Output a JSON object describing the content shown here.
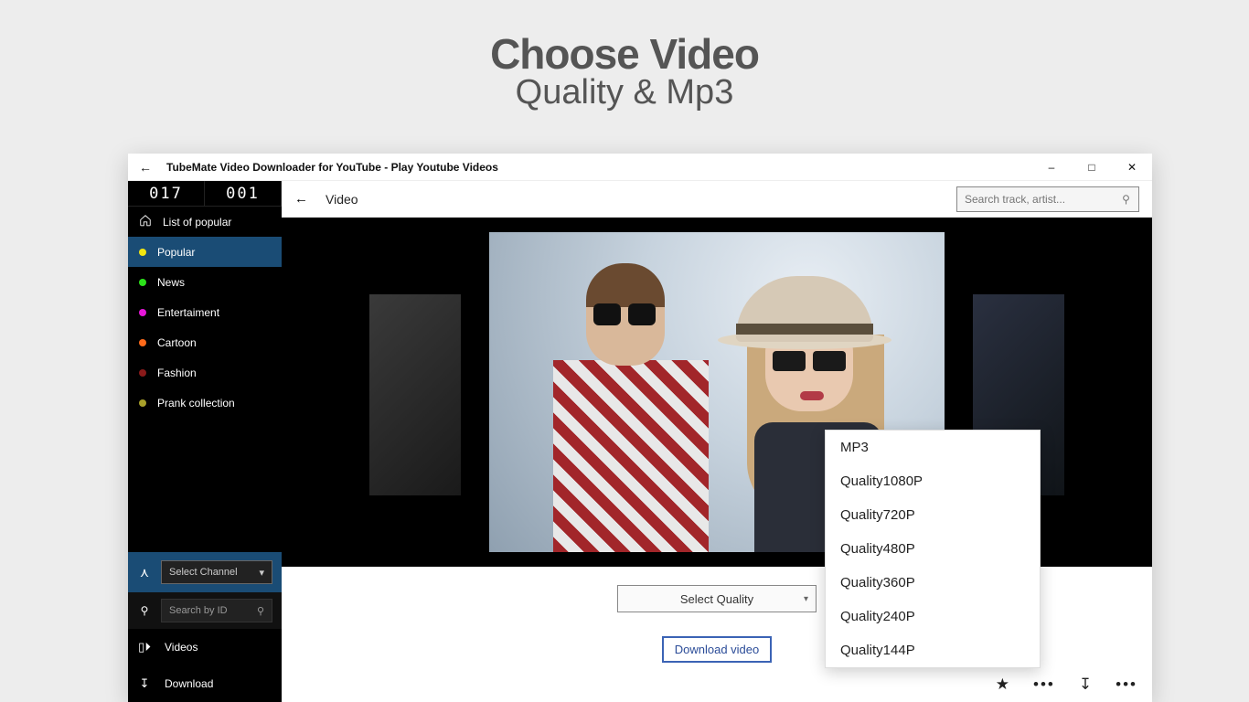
{
  "hero": {
    "title": "Choose Video",
    "subtitle": "Quality & Mp3"
  },
  "window": {
    "title": "TubeMate Video Downloader for YouTube - Play Youtube Videos",
    "counters": [
      "017",
      "001"
    ]
  },
  "sidebar": {
    "items": [
      {
        "label": "List of popular",
        "dot": "#fff",
        "iconType": "home"
      },
      {
        "label": "Popular",
        "dot": "#f2e611",
        "active": true
      },
      {
        "label": "News",
        "dot": "#2ce21a"
      },
      {
        "label": "Entertaiment",
        "dot": "#e516d8"
      },
      {
        "label": "Cartoon",
        "dot": "#ff6a1a"
      },
      {
        "label": "Fashion",
        "dot": "#8b1a1a"
      },
      {
        "label": "Prank collection",
        "dot": "#a8a02a"
      }
    ],
    "channelButton": "Select Channel",
    "searchIdPlaceholder": "Search by ID",
    "videos": "Videos",
    "download": "Download"
  },
  "main": {
    "breadcrumb": "Video",
    "searchPlaceholder": "Search track, artist...",
    "selectQualityLabel": "Select Quality",
    "downloadButton": "Download video",
    "qualityOptions": [
      "MP3",
      "Quality1080P",
      "Quality720P",
      "Quality480P",
      "Quality360P",
      "Quality240P",
      "Quality144P"
    ]
  }
}
